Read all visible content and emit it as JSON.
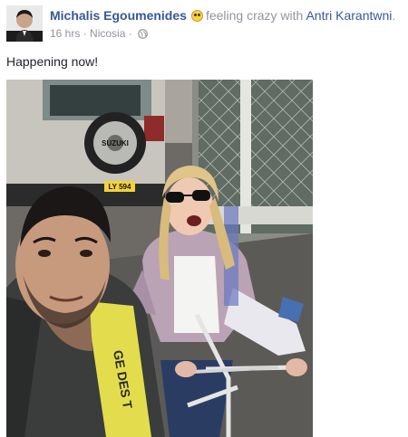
{
  "post": {
    "author": "Michalis Egoumenides",
    "feeling": "feeling crazy with",
    "tagged": "Antri Karantwni",
    "punct": ".",
    "time": "16 hrs",
    "sep": "·",
    "location": "Nicosia",
    "sep2": "·",
    "text": "Happening now!"
  },
  "icons": {
    "feeling": "crazy-face-emoji",
    "privacy": "globe-icon"
  },
  "colors": {
    "link": "#365899",
    "meta": "#90949c",
    "text": "#1d2129"
  },
  "photo": {
    "car_badge": "SUZUKI",
    "plate": "LY 594",
    "shirt_print": "GE DES T"
  }
}
